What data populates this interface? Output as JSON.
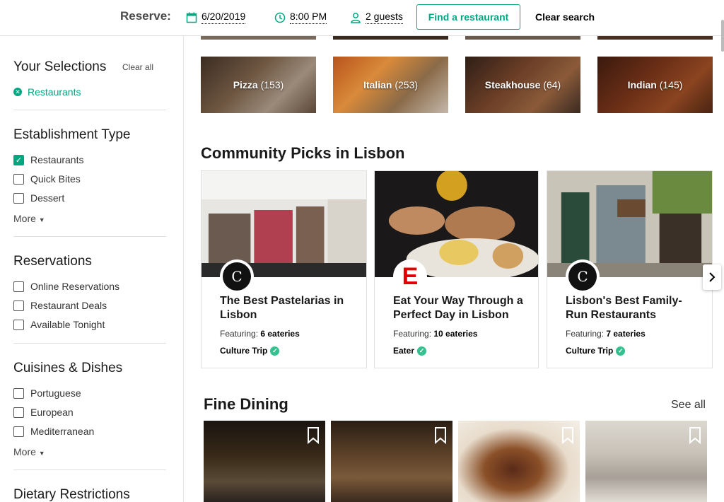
{
  "header": {
    "reserve_label": "Reserve:",
    "date": "6/20/2019",
    "time": "8:00 PM",
    "guests": "2 guests",
    "find_button": "Find a restaurant",
    "clear_search": "Clear search"
  },
  "sidebar": {
    "your_selections": {
      "title": "Your Selections",
      "clear_all": "Clear all",
      "selected": "Restaurants"
    },
    "establishment": {
      "title": "Establishment Type",
      "items": [
        "Restaurants",
        "Quick Bites",
        "Dessert"
      ],
      "checked": [
        true,
        false,
        false
      ],
      "more": "More"
    },
    "reservations": {
      "title": "Reservations",
      "items": [
        "Online Reservations",
        "Restaurant Deals",
        "Available Tonight"
      ]
    },
    "cuisines": {
      "title": "Cuisines & Dishes",
      "items": [
        "Portuguese",
        "European",
        "Mediterranean"
      ],
      "more": "More"
    },
    "dietary": {
      "title": "Dietary Restrictions"
    }
  },
  "categories": [
    {
      "name": "Pizza",
      "count": "(153)"
    },
    {
      "name": "Italian",
      "count": "(253)"
    },
    {
      "name": "Steakhouse",
      "count": "(64)"
    },
    {
      "name": "Indian",
      "count": "(145)"
    }
  ],
  "community": {
    "title": "Community Picks in Lisbon",
    "cards": [
      {
        "title": "The Best Pastelarias in Lisbon",
        "featuring_label": "Featuring:",
        "featuring_count": "6 eateries",
        "source": "Culture Trip",
        "logo_char": "C"
      },
      {
        "title": "Eat Your Way Through a Perfect Day in Lisbon",
        "featuring_label": "Featuring:",
        "featuring_count": "10 eateries",
        "source": "Eater",
        "logo_char": "E"
      },
      {
        "title": "Lisbon's Best Family-Run Restaurants",
        "featuring_label": "Featuring:",
        "featuring_count": "7 eateries",
        "source": "Culture Trip",
        "logo_char": "C"
      }
    ]
  },
  "fine_dining": {
    "title": "Fine Dining",
    "see_all": "See all"
  },
  "icons": {
    "date": "calendar-icon",
    "time": "clock-icon",
    "guests": "person-icon",
    "next": "chevron-right-icon",
    "bookmark": "bookmark-icon",
    "verified": "check-circle-icon"
  },
  "colors": {
    "accent": "#00a680",
    "verified": "#34c08f",
    "eater_red": "#e40000"
  }
}
